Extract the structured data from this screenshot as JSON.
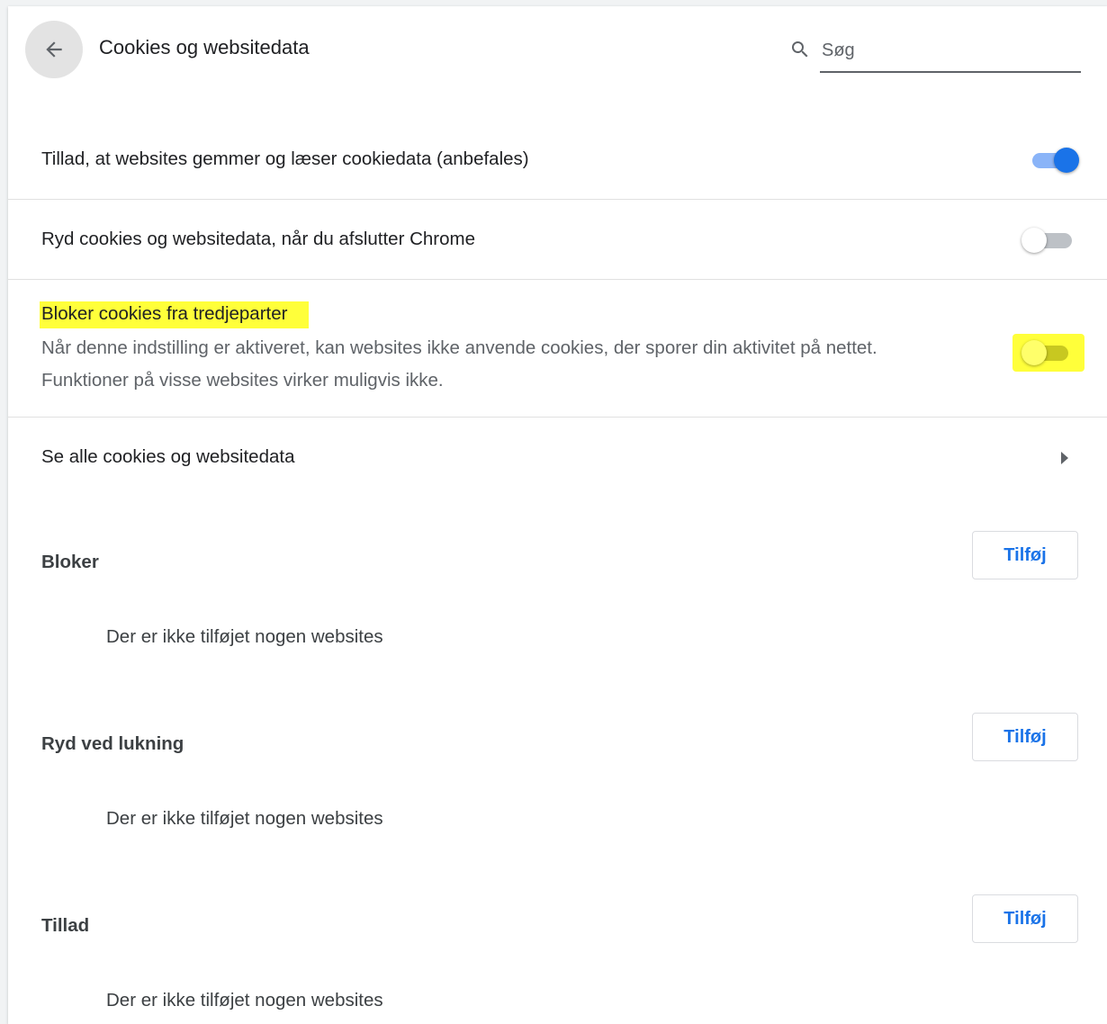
{
  "header": {
    "title": "Cookies og websitedata",
    "search_placeholder": "Søg"
  },
  "settings": {
    "allow_cookies": {
      "label": "Tillad, at websites gemmer og læser cookiedata (anbefales)",
      "enabled": true
    },
    "clear_on_exit": {
      "label": "Ryd cookies og websitedata, når du afslutter Chrome",
      "enabled": false
    },
    "block_third_party": {
      "label": "Bloker cookies fra tredjeparter",
      "description_line1": "Når denne indstilling er aktiveret, kan websites ikke anvende cookies, der sporer din aktivitet på nettet.",
      "description_line2": "Funktioner på visse websites virker muligvis ikke.",
      "enabled": false,
      "highlight_color": "#ffff3a"
    },
    "see_all": {
      "label": "Se alle cookies og websitedata"
    }
  },
  "sections": [
    {
      "title": "Bloker",
      "add_label": "Tilføj",
      "empty_text": "Der er ikke tilføjet nogen websites"
    },
    {
      "title": "Ryd ved lukning",
      "add_label": "Tilføj",
      "empty_text": "Der er ikke tilføjet nogen websites"
    },
    {
      "title": "Tillad",
      "add_label": "Tilføj",
      "empty_text": "Der er ikke tilføjet nogen websites"
    }
  ],
  "colors": {
    "accent": "#1a73e8",
    "toggle_track_on": "#8ab4f8",
    "toggle_track_off": "#bdc1c6"
  },
  "icons": {
    "back": "arrow-back-icon",
    "search": "search-icon",
    "chevron": "chevron-right-icon"
  }
}
